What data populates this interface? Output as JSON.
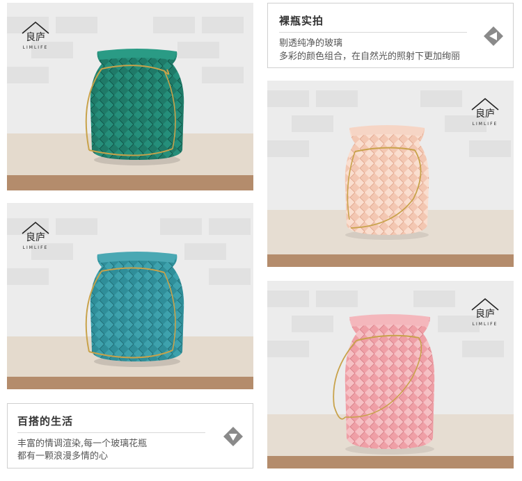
{
  "brand": {
    "logo_mark": "良庐",
    "logo_text": "LIMLIFE"
  },
  "panel_top": {
    "title": "裸瓶实拍",
    "lines": [
      "剔透纯净的玻璃",
      "多彩的颜色组合，在自然光的照射下更加绚丽"
    ],
    "badge_icon": "arrow-left-diamond-icon"
  },
  "panel_bottom": {
    "title": "百搭的生活",
    "lines": [
      "丰富的情调渲染,每一个玻璃花瓶",
      "都有一颗浪漫多情的心"
    ],
    "badge_icon": "arrow-down-diamond-icon"
  },
  "photos": [
    {
      "id": "green",
      "glass_color": "#1f7a68"
    },
    {
      "id": "teal",
      "glass_color": "#2f8e99"
    },
    {
      "id": "peach",
      "glass_color": "#f3c7b2"
    },
    {
      "id": "pink",
      "glass_color": "#ef9fa6"
    }
  ],
  "colors": {
    "wall": "#e9e9e9",
    "shelf_top": "#e3d9cc",
    "shelf_edge": "#b08a6b",
    "handle": "#c8a24a",
    "badge": "#8a8a8a"
  }
}
